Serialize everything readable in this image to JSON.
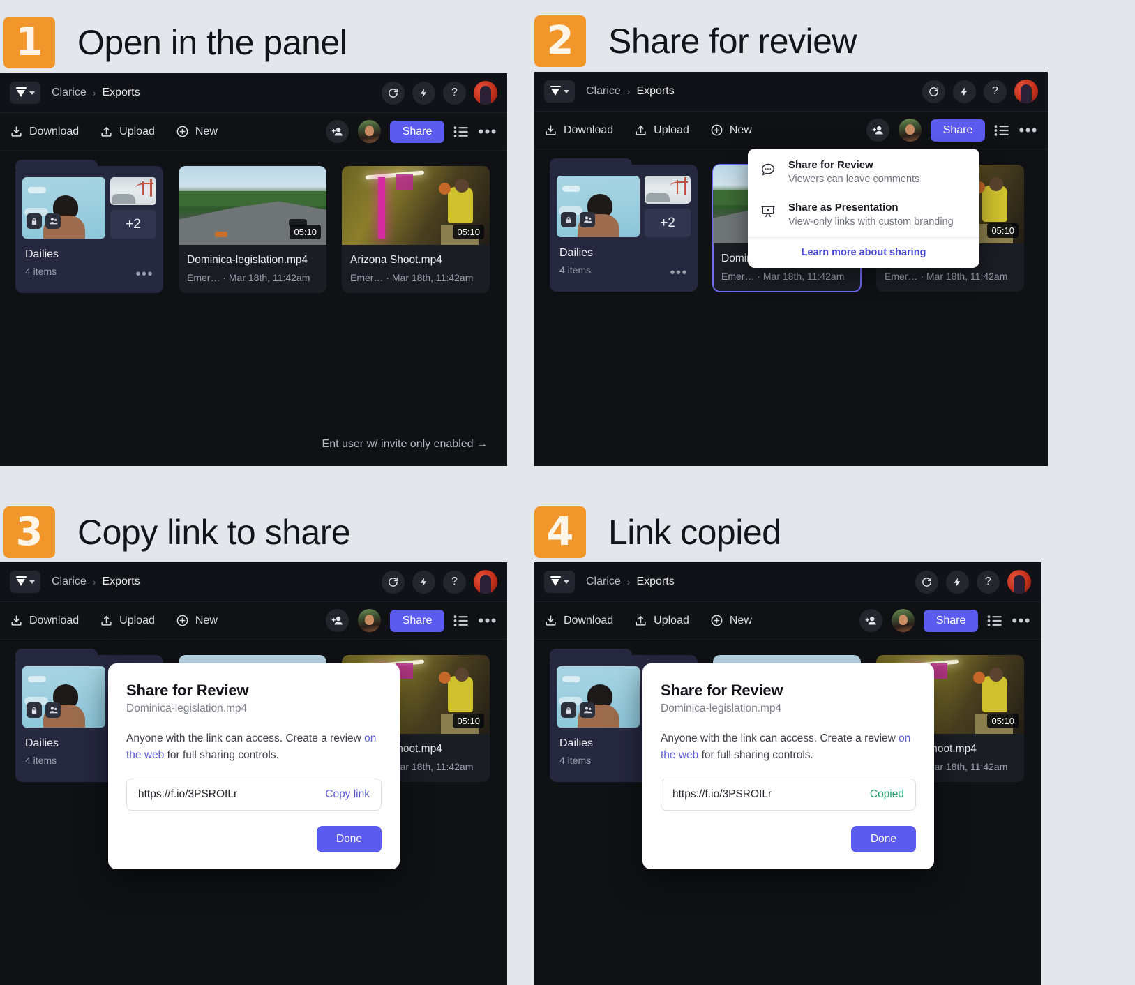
{
  "steps": [
    {
      "number": "1",
      "title": "Open in the panel"
    },
    {
      "number": "2",
      "title": "Share for review"
    },
    {
      "number": "3",
      "title": "Copy link to share"
    },
    {
      "number": "4",
      "title": "Link copied"
    }
  ],
  "app": {
    "breadcrumb": {
      "root": "Clarice",
      "separator": "›",
      "current": "Exports"
    },
    "topbar_icons": {
      "refresh": "refresh-icon",
      "bolt": "lightning-icon",
      "help": "?"
    },
    "actions": {
      "download": "Download",
      "upload": "Upload",
      "new": "New",
      "share": "Share"
    },
    "cards": [
      {
        "type": "folder",
        "name": "Dailies",
        "sub": "4 items",
        "overflow_count": "+2"
      },
      {
        "type": "file",
        "name": "Dominica-legislation.mp4",
        "sub": "Emer… · Mar 18th, 11:42am",
        "duration": "05:10"
      },
      {
        "type": "file",
        "name": "Arizona Shoot.mp4",
        "sub": "Emer… · Mar 18th, 11:42am",
        "duration": "05:10"
      }
    ],
    "hint": "Ent user w/ invite only enabled →"
  },
  "share_popover": {
    "items": [
      {
        "title": "Share for Review",
        "sub": "Viewers can leave comments",
        "icon": "comment-bubble-icon"
      },
      {
        "title": "Share as Presentation",
        "sub": "View-only links with custom branding",
        "icon": "presentation-icon"
      }
    ],
    "link": "Learn more about sharing"
  },
  "share_modal": {
    "title": "Share for Review",
    "filename": "Dominica-legislation.mp4",
    "desc_pre": "Anyone with the link can access. Create a review ",
    "desc_link": "on the web",
    "desc_post": " for full sharing controls.",
    "url": "https://f.io/3PSROILr",
    "copy_label": "Copy link",
    "copied_label": "Copied",
    "done_label": "Done"
  },
  "colors": {
    "accent_orange": "#f0962b",
    "accent_purple": "#5b5bf0",
    "page_bg": "#e3e7ec",
    "app_bg": "#0f1115",
    "success_green": "#23a06b"
  }
}
